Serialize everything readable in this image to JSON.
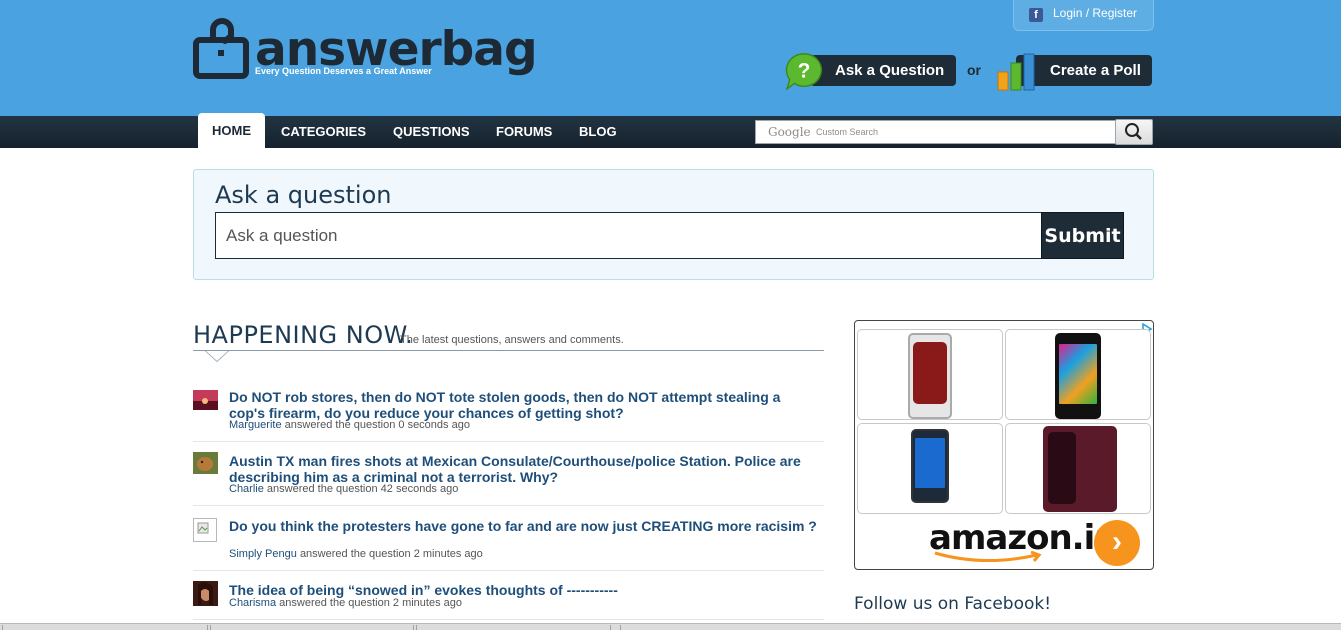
{
  "brand": {
    "name": "answerbag",
    "tagline": "Every Question Deserves a Great Answer"
  },
  "header": {
    "login_label": "Login / Register",
    "ask_button": "Ask a Question",
    "or_text": "or",
    "poll_button": "Create a Poll"
  },
  "nav": {
    "items": [
      "HOME",
      "CATEGORIES",
      "QUESTIONS",
      "FORUMS",
      "BLOG"
    ],
    "active": "HOME"
  },
  "search": {
    "provider": "Google",
    "placeholder": "Custom Search"
  },
  "ask_box": {
    "title": "Ask a question",
    "placeholder": "Ask a question",
    "submit": "Submit"
  },
  "happening": {
    "title": "HAPPENING NOW.",
    "subtitle": "The latest questions, answers and comments."
  },
  "feed": [
    {
      "question": "Do NOT rob stores, then do NOT tote stolen goods, then do NOT attempt stealing a cop's firearm, do you reduce your chances of getting shot?",
      "user": "Marguerite",
      "action": "answered the question",
      "time": "0 seconds ago"
    },
    {
      "question": "Austin TX man fires shots at Mexican Consulate/Courthouse/police Station. Police are describing him as a criminal not a terrorist. Why?",
      "user": "Charlie",
      "action": "answered the question",
      "time": "42 seconds ago"
    },
    {
      "question": "Do you think the protesters have gone to far and are now just CREATING more racisim ?",
      "user": "Simply Pengu",
      "action": "answered the question",
      "time": "2 minutes ago"
    },
    {
      "question": "The idea of being “snowed in” evokes thoughts of -----------",
      "user": "Charisma",
      "action": "answered the question",
      "time": "2 minutes ago"
    }
  ],
  "ad": {
    "brand": "amazon.in",
    "arrow": "›"
  },
  "sidebar": {
    "follow_title": "Follow us on Facebook!"
  },
  "colors": {
    "header_bg": "#4aa3e0",
    "nav_bg": "#1a2a36",
    "dark_btn": "#1e2c38",
    "link": "#1e4e7a",
    "ask_box_bg": "#f0f8fd"
  }
}
